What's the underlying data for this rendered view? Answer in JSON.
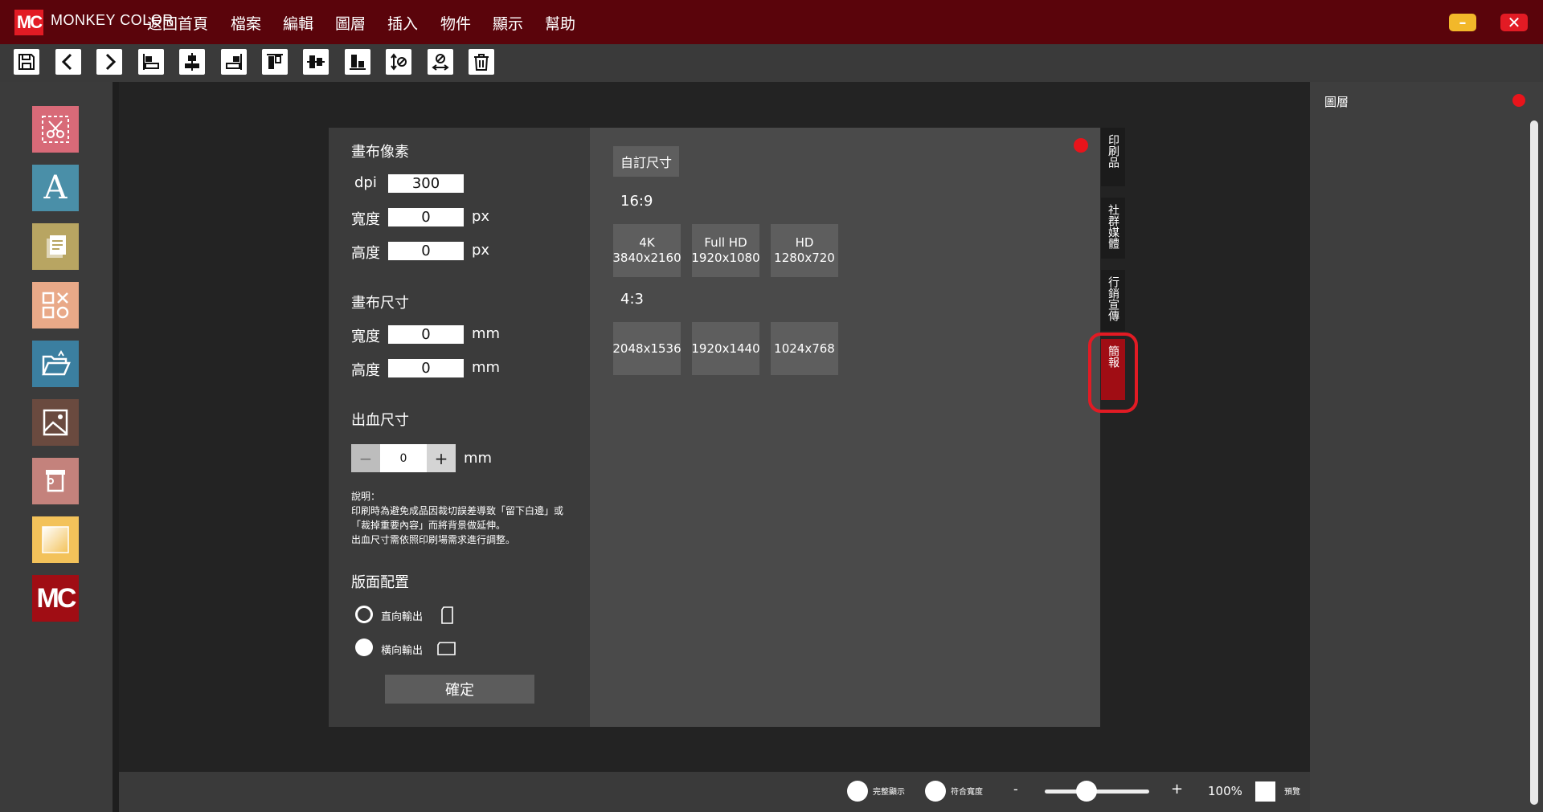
{
  "app": {
    "logo_text": "MC",
    "brand": "MONKEY COLOR",
    "menu": [
      "返回首頁",
      "檔案",
      "編輯",
      "圖層",
      "插入",
      "物件",
      "顯示",
      "幫助"
    ],
    "minimize_glyph": "–",
    "close_glyph": "✕"
  },
  "toolbar": {
    "tools": [
      "save-icon",
      "undo-icon",
      "redo-icon",
      "align-left-icon",
      "align-center-icon",
      "align-right-icon",
      "align-top-icon",
      "align-middle-icon",
      "align-bottom-icon",
      "flip-vertical-icon",
      "flip-horizontal-icon",
      "trash-icon"
    ]
  },
  "sidebar": {
    "tools": [
      {
        "name": "cutout-tool",
        "icon": "scissors-icon",
        "color": "#d86a78"
      },
      {
        "name": "text-tool",
        "icon": "text-a-icon",
        "color": "#4a8fa8",
        "glyph": "A"
      },
      {
        "name": "clipboard-tool",
        "icon": "clipboard-icon",
        "color": "#b8a562"
      },
      {
        "name": "shapes-tool",
        "icon": "shapes-icon",
        "color": "#e9a988"
      },
      {
        "name": "open-folder-tool",
        "icon": "open-folder-icon",
        "color": "#3b7fa0"
      },
      {
        "name": "image-tool",
        "icon": "image-icon",
        "color": "#6a4a3f"
      },
      {
        "name": "template-tool",
        "icon": "template-icon",
        "color": "#c4827c"
      },
      {
        "name": "gradient-tool",
        "icon": "gradient-icon",
        "color": "#f3c25a"
      },
      {
        "name": "mc-logo-tool",
        "icon": "mc-logo-icon",
        "color": "#a00d14",
        "glyph": "MC"
      }
    ]
  },
  "canvas_settings": {
    "pixel_title": "畫布像素",
    "dpi_label": "dpi",
    "dpi_value": "300",
    "width_label": "寬度",
    "height_label": "高度",
    "px_width_value": "0",
    "px_height_value": "0",
    "px_unit": "px",
    "size_title": "畫布尺寸",
    "mm_width_value": "0",
    "mm_height_value": "0",
    "mm_unit": "mm",
    "bleed_title": "出血尺寸",
    "bleed_value": "0",
    "bleed_minus": "−",
    "bleed_plus": "+",
    "note": "說明：\n印刷時為避免成品因裁切誤差導致「留下白邊」或「裁掉重要內容」而將背景做延伸。\n出血尺寸需依照印刷場需求進行調整。",
    "layout_title": "版面配置",
    "portrait_label": "直向輸出",
    "landscape_label": "橫向輸出",
    "selected_orientation": "landscape",
    "confirm_label": "確定"
  },
  "presets": {
    "custom_label": "自訂尺寸",
    "ratio_16_9": "16:9",
    "items_16_9": [
      {
        "name": "4K",
        "size": "3840x2160"
      },
      {
        "name": "Full HD",
        "size": "1920x1080"
      },
      {
        "name": "HD",
        "size": "1280x720"
      }
    ],
    "ratio_4_3": "4:3",
    "items_4_3": [
      "2048x1536",
      "1920x1440",
      "1024x768"
    ]
  },
  "category_tabs": [
    {
      "label": "印刷品",
      "active": false
    },
    {
      "label": "社群媒體",
      "active": false
    },
    {
      "label": "行銷宣傳",
      "active": false
    },
    {
      "label": "簡報",
      "active": true
    }
  ],
  "right_panel": {
    "title": "圖層"
  },
  "bottombar": {
    "fit_all_label": "完整顯示",
    "fit_width_label": "符合寬度",
    "zoom_minus": "-",
    "zoom_plus": "+",
    "zoom_value": "100%",
    "zoom_level": 0.4,
    "preview_label": "預覽"
  },
  "colors": {
    "title_bar": "#5a040b",
    "accent_red": "#e21b24",
    "active_tab": "#a00d14"
  }
}
